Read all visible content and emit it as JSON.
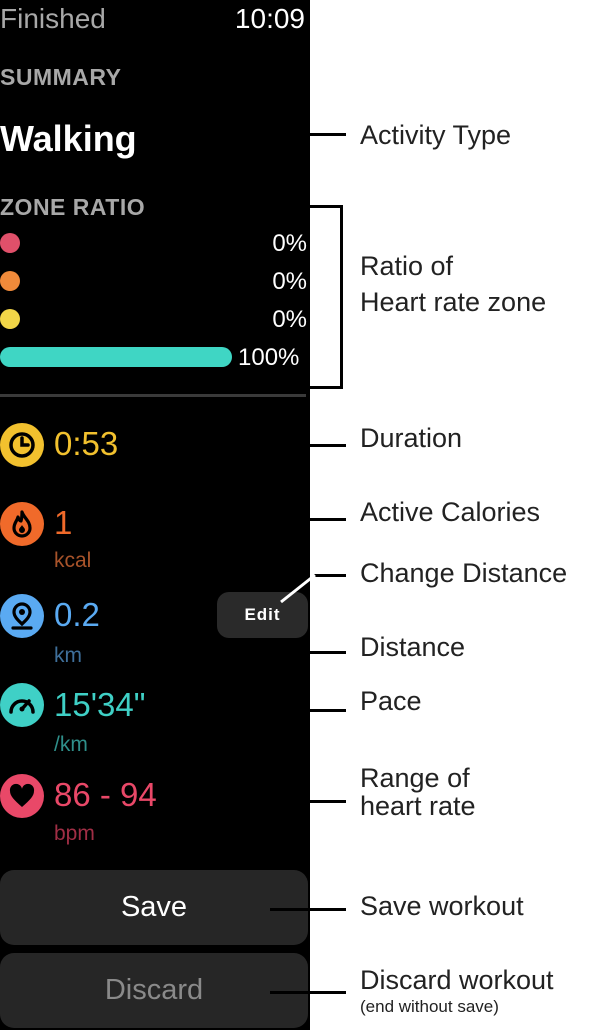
{
  "status_bar": {
    "title": "Finished",
    "time": "10:09"
  },
  "summary": {
    "heading": "SUMMARY",
    "activity_type": "Walking"
  },
  "zone_ratio": {
    "heading": "ZONE RATIO",
    "zones": [
      {
        "color": "#e0506a",
        "percent_label": "0%",
        "ratio": 0
      },
      {
        "color": "#f08a3a",
        "percent_label": "0%",
        "ratio": 0
      },
      {
        "color": "#f2d648",
        "percent_label": "0%",
        "ratio": 0
      },
      {
        "color": "#3fd6c4",
        "percent_label": "100%",
        "ratio": 1
      }
    ]
  },
  "metrics": {
    "duration": {
      "icon": "clock-icon",
      "value": "0:53",
      "color": "#f2c12e"
    },
    "calories": {
      "icon": "flame-icon",
      "value": "1",
      "unit": "kcal",
      "color": "#f06a2a",
      "unit_color": "#a8532a"
    },
    "distance": {
      "icon": "location-pin-icon",
      "value": "0.2",
      "unit": "km",
      "color": "#5aaaf2",
      "unit_color": "#3f6f9a"
    },
    "pace": {
      "icon": "speedometer-icon",
      "value": "15'34\"",
      "unit": "/km",
      "color": "#3fd0c6",
      "unit_color": "#2f8f8a"
    },
    "heart_rate": {
      "icon": "heart-icon",
      "value": "86 - 94",
      "unit": "bpm",
      "color": "#e94868",
      "unit_color": "#a02e45"
    }
  },
  "edit_button": {
    "label": "Edit"
  },
  "actions": {
    "save_label": "Save",
    "discard_label": "Discard"
  },
  "annotations": {
    "activity_type": "Activity Type",
    "zone_ratio_line1": "Ratio of",
    "zone_ratio_line2": "Heart rate zone",
    "duration": "Duration",
    "active_calories": "Active Calories",
    "change_distance": "Change Distance",
    "distance": "Distance",
    "pace": "Pace",
    "heart_rate_line1": "Range of",
    "heart_rate_line2": "heart rate",
    "save_workout": "Save workout",
    "discard_workout": "Discard workout",
    "discard_note": "(end without save)"
  }
}
